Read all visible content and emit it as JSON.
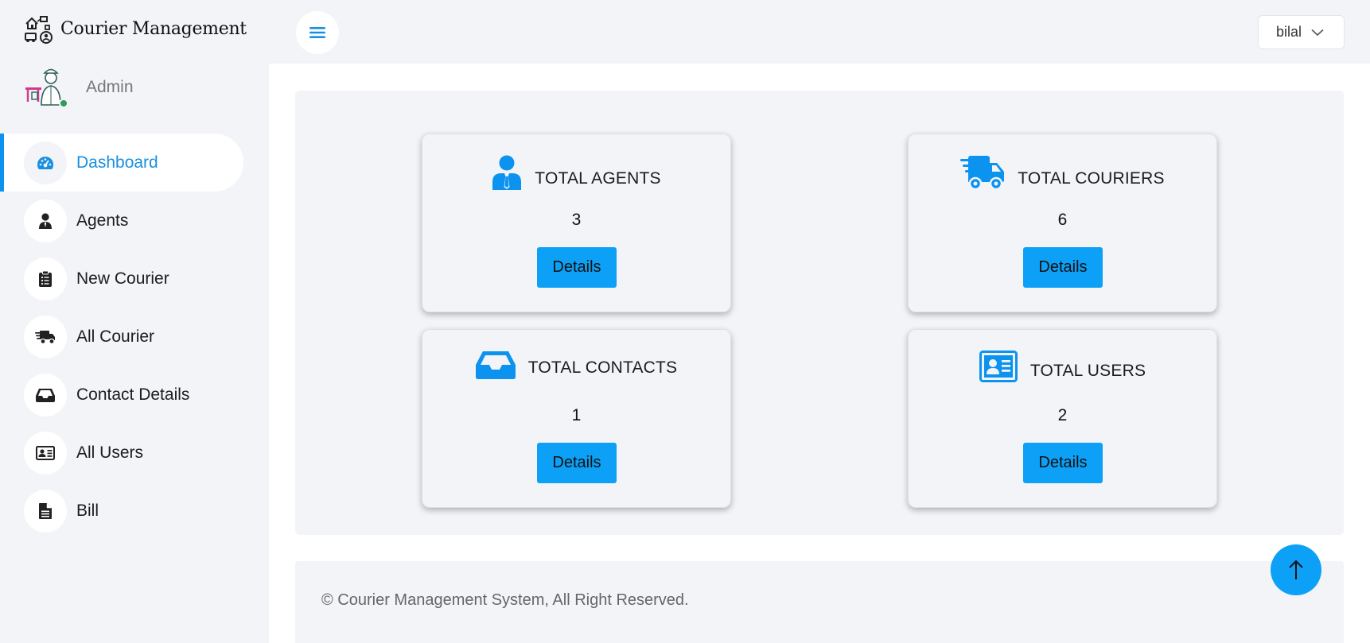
{
  "app": {
    "title": "Courier Management"
  },
  "profile": {
    "role": "Admin"
  },
  "sidebar": {
    "items": [
      {
        "label": "Dashboard",
        "icon": "dashboard-gauge-icon",
        "active": true
      },
      {
        "label": "Agents",
        "icon": "user-tie-icon"
      },
      {
        "label": "New Courier",
        "icon": "clipboard-list-icon"
      },
      {
        "label": "All Courier",
        "icon": "truck-fast-icon"
      },
      {
        "label": "Contact Details",
        "icon": "inbox-icon"
      },
      {
        "label": "All Users",
        "icon": "id-card-icon"
      },
      {
        "label": "Bill",
        "icon": "file-lines-icon"
      }
    ]
  },
  "header": {
    "user": "bilal",
    "menu_icon": "hamburger-icon",
    "dropdown_icon": "chevron-down-icon"
  },
  "cards": [
    {
      "title": "TOTAL AGENTS",
      "count": "3",
      "button": "Details",
      "icon": "user-tie-icon"
    },
    {
      "title": "TOTAL COURIERS",
      "count": "6",
      "button": "Details",
      "icon": "truck-fast-icon"
    },
    {
      "title": "TOTAL CONTACTS",
      "count": "1",
      "button": "Details",
      "icon": "inbox-icon"
    },
    {
      "title": "TOTAL USERS",
      "count": "2",
      "button": "Details",
      "icon": "id-card-icon"
    }
  ],
  "footer": {
    "text": "© Courier Management System, All Right Reserved."
  },
  "colors": {
    "accent": "#0ca0f7",
    "active_text": "#1a8fe0",
    "panel_bg": "#f2f4f7"
  }
}
